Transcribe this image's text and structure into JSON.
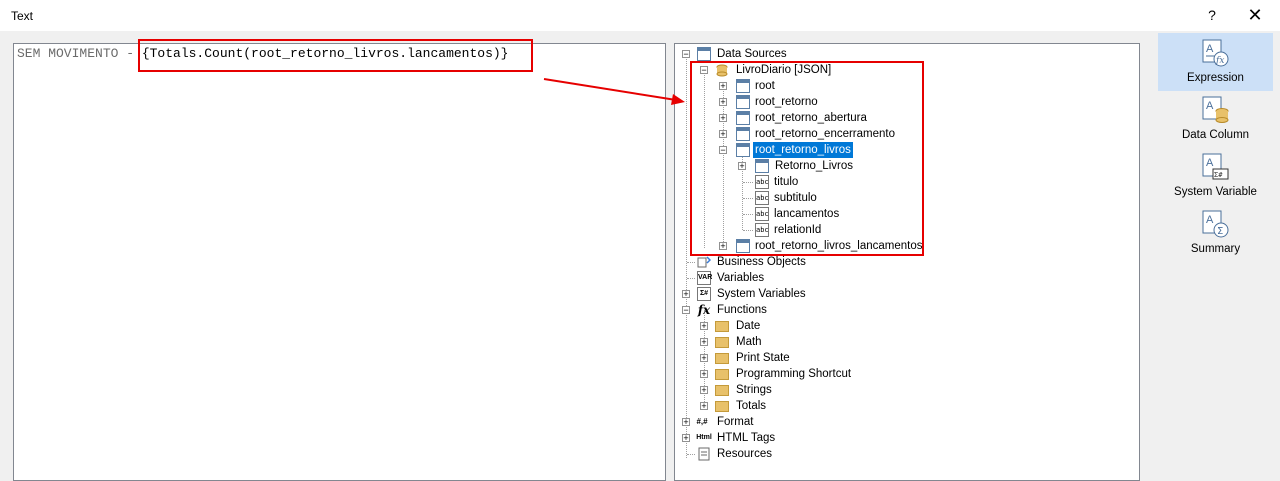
{
  "window": {
    "title": "Text",
    "help": "?",
    "close": "✕"
  },
  "editor": {
    "prefix": "SEM MOVIMENTO - ",
    "expression": "{Totals.Count(root_retorno_livros.lancamentos)}"
  },
  "tree": {
    "data_sources": "Data Sources",
    "livro_diario": "LivroDiario [JSON]",
    "root": "root",
    "root_retorno": "root_retorno",
    "root_retorno_abertura": "root_retorno_abertura",
    "root_retorno_encerramento": "root_retorno_encerramento",
    "root_retorno_livros": "root_retorno_livros",
    "retorno_livros": "Retorno_Livros",
    "titulo": "titulo",
    "subtitulo": "subtitulo",
    "lancamentos": "lancamentos",
    "relation_id": "relationId",
    "root_retorno_livros_lancamentos": "root_retorno_livros_lancamentos",
    "business_objects": "Business Objects",
    "variables": "Variables",
    "system_variables": "System Variables",
    "functions": "Functions",
    "date": "Date",
    "math": "Math",
    "print_state": "Print State",
    "programming_shortcut": "Programming Shortcut",
    "strings": "Strings",
    "totals": "Totals",
    "format": "Format",
    "html_tags": "HTML Tags",
    "resources": "Resources",
    "abc": "abc",
    "var_tag": "VAR",
    "sys_tag": "Σ#",
    "fx": "fx",
    "format_tag": "#,#",
    "html_tag": "Html"
  },
  "modes": {
    "expression": "Expression",
    "data_column": "Data Column",
    "system_variable": "System Variable",
    "summary": "Summary"
  },
  "colors": {
    "selection": "#0078d7",
    "annotation": "#e60000",
    "active_mode": "#cce0f7"
  }
}
